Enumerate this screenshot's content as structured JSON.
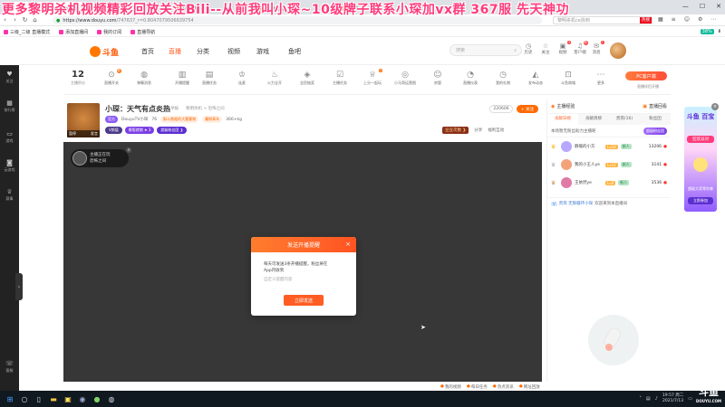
{
  "overlay": {
    "title": "更多黎明杀机视频精彩回放关注Bili--从前我叫小琛~10级牌子联系小琛加vx群   367服  先天神功"
  },
  "browser": {
    "tabs": [
      {
        "label": "小琛：天气有点炎热 - 斗鱼直播"
      },
      {
        "label": "斗鱼直播"
      },
      {
        "label": "Douyu"
      },
      {
        "label": "斗鱼直播"
      },
      {
        "label": "斗鱼"
      }
    ],
    "new_tab": "+",
    "url_host": "https://www.douyu.com",
    "url_path": "/747637_r=0.8047079506639754",
    "search_placeholder": "黎明杀机ce找到",
    "search_hot": "热搜",
    "bookmarks": [
      "三级_二级 直播模式",
      "添加直播间",
      "我的订阅",
      "直播导航"
    ],
    "battery": "38%"
  },
  "site": {
    "logo": "斗鱼",
    "nav": [
      "首页",
      "直播",
      "分类",
      "视频",
      "游戏",
      "鱼吧"
    ],
    "search_placeholder": "搜索",
    "header_icons": [
      {
        "icon": "clock-icon",
        "label": "历史",
        "badge": ""
      },
      {
        "icon": "star-icon",
        "label": "关注",
        "badge": ""
      },
      {
        "icon": "video-icon",
        "label": "视频",
        "badge": "3"
      },
      {
        "icon": "bell-icon",
        "label": "客户端",
        "badge": "新"
      },
      {
        "icon": "download-icon",
        "label": "下载",
        "badge": ""
      },
      {
        "icon": "envelope-icon",
        "label": "消息",
        "badge": "1"
      }
    ],
    "sidebar": [
      {
        "icon": "heart-icon",
        "label": "关注"
      },
      {
        "icon": "grid-icon",
        "label": "排行榜"
      },
      {
        "icon": "tv-icon",
        "label": "游戏"
      },
      {
        "icon": "gamepad-icon",
        "label": "云游戏"
      },
      {
        "icon": "trophy-icon",
        "label": "赛事"
      },
      {
        "icon": "help-icon",
        "label": "客服"
      }
    ]
  },
  "toolstrip": {
    "level_num": "12",
    "level_label": "主播积分",
    "items": [
      {
        "icon": "toggle-icon",
        "label": "直播开关",
        "badge": "新"
      },
      {
        "icon": "wave-icon",
        "label": "弹幕消息",
        "badge": ""
      },
      {
        "icon": "chart-icon",
        "label": "开播提醒",
        "badge": ""
      },
      {
        "icon": "ad-icon",
        "label": "直播任务",
        "badge": ""
      },
      {
        "icon": "crown-icon",
        "label": "连麦",
        "badge": ""
      },
      {
        "icon": "flame-icon",
        "label": "火力全开",
        "badge": ""
      },
      {
        "icon": "shield-icon",
        "label": "全民抽奖",
        "badge": ""
      },
      {
        "icon": "check-icon",
        "label": "主播任务",
        "badge": ""
      },
      {
        "icon": "trophy-icon",
        "label": "上分一起玩",
        "badge": "3"
      },
      {
        "icon": "game-icon",
        "label": "小马哥运营图",
        "badge": ""
      },
      {
        "icon": "user-icon",
        "label": "房管",
        "badge": ""
      },
      {
        "icon": "gauge-icon",
        "label": "直播仪表",
        "badge": ""
      },
      {
        "icon": "clock-icon",
        "label": "我的礼物",
        "badge": ""
      },
      {
        "icon": "megaphone-icon",
        "label": "发布动态",
        "badge": ""
      },
      {
        "icon": "cart-icon",
        "label": "斗鱼商城",
        "badge": ""
      },
      {
        "icon": "more-icon",
        "label": "更多",
        "badge": ""
      }
    ],
    "pc_client": "PC客户端",
    "pc_client_sub": "直播伴侣开播"
  },
  "room": {
    "title": "小琛：天气有点炎热",
    "report": "举报",
    "category": "黎明杀机 > 恐怖之间",
    "meta_tag": "官方",
    "meta_user": "DouyuTV小琛",
    "meta_level": "76",
    "meta_fan": "斛斗数据的大猩猩钢",
    "meta_badge": "暑期青年",
    "meta_location": "366+kg",
    "cover_left": "暂停",
    "cover_right": "发言",
    "badges": [
      "V颜值",
      "模版就绪 ★ 3",
      "超级粉丝团 ❯"
    ],
    "hot_value": "220606",
    "follow": "+ 关注",
    "actions": [
      "豆豆次数 ❯",
      "分享",
      "福利互动"
    ]
  },
  "player": {
    "streamer_line1": "主播正在玩",
    "streamer_line2": "恐怖之间",
    "close": "×"
  },
  "modal": {
    "title": "发送开播提醒",
    "close": "×",
    "body_line1": "每天可发送3条开播提醒，粉丝将在",
    "body_line2": "App内收到",
    "input_placeholder": "自定义提醒内容",
    "button": "立即发送"
  },
  "player_bar": [
    {
      "dot": "●",
      "label": "我的视频"
    },
    {
      "dot": "●",
      "label": "每日任务"
    },
    {
      "dot": "●",
      "label": "热点资讯"
    },
    {
      "dot": "●",
      "label": "网址回放"
    }
  ],
  "right_panel": {
    "left_label": "主播经验",
    "right_label": "直播回看",
    "tabs": [
      "贡献日榜",
      "贡献周榜",
      "贵宾(16)",
      "粉丝团"
    ],
    "notice": "本场暂无粉丝助力主播呢",
    "notice_btn": "超级粉丝团",
    "rows": [
      {
        "crown": "♛",
        "name": "静瑜的小方",
        "lv": "Lv18",
        "lv2": "新人",
        "score": "13206",
        "dot": "●"
      },
      {
        "crown": "♛",
        "name": "我的小王人ye",
        "lv": "Lv12",
        "lv2": "新人",
        "score": "3141",
        "dot": "●"
      },
      {
        "crown": "♛",
        "name": "王依然ye",
        "lv": "Lv8",
        "lv2": "新人",
        "score": "3536",
        "dot": "●"
      }
    ],
    "chat_badge": "V",
    "chat_user": "贵宾 无限循环小琛",
    "chat_text": "欢迎来到本直播间",
    "avatar_colors": [
      "#b9a7ff",
      "#f3a37a",
      "#e07aa6"
    ]
  },
  "right_ad": {
    "title": "斗鱼 百宝",
    "tag": "狂欢派对",
    "sub": "超级大奖等你拿",
    "cta": "立即参加",
    "close": "×"
  },
  "taskbar": {
    "time": "19:57 周二",
    "date": "2021/7/13"
  },
  "watermark": {
    "big": "斗鱼",
    "small": "DOUYU.COM"
  }
}
